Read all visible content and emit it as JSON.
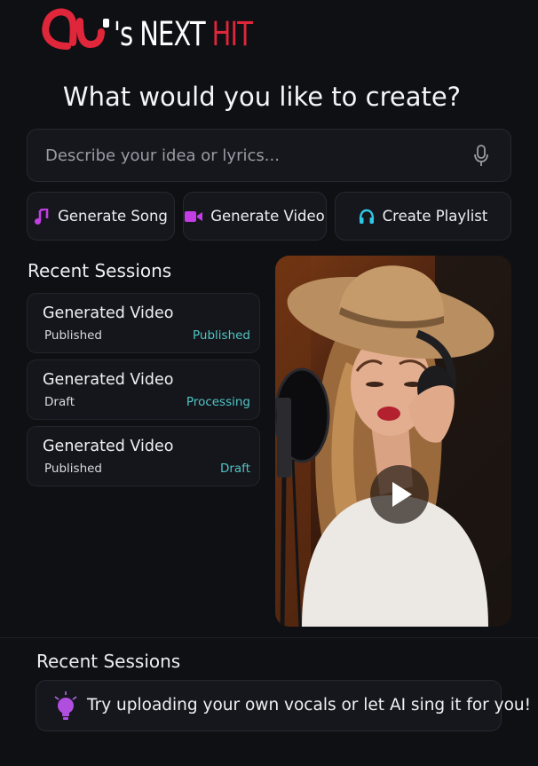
{
  "brand": {
    "logo_mark": "AI",
    "logo_s": "'s",
    "logo_next": "NEXT",
    "logo_hit": "HIT",
    "accent_red": "#e0263a"
  },
  "headline": "What would you like to create?",
  "prompt": {
    "placeholder": "Describe your idea or lyrics...",
    "value": "",
    "icon": "microphone-icon"
  },
  "actions": [
    {
      "label": "Generate Song",
      "icon": "music-note-icon",
      "color": "#c23de3"
    },
    {
      "label": "Generate Video",
      "icon": "video-camera-icon",
      "color": "#c23de3"
    },
    {
      "label": "Create Playlist",
      "icon": "headphones-icon",
      "color": "#2ec8e6"
    }
  ],
  "recent_sessions": {
    "title": "Recent Sessions",
    "items": [
      {
        "title": "Generated Video",
        "subtitle": "Published",
        "status": "Published"
      },
      {
        "title": "Generated Video",
        "subtitle": "Draft",
        "status": "Processing"
      },
      {
        "title": "Generated Video",
        "subtitle": "Published",
        "status": "Draft"
      }
    ],
    "status_color": "#4fc4c4"
  },
  "video_preview": {
    "icon": "play-icon"
  },
  "tips": {
    "title": "Recent Sessions",
    "text": "Try uploading your own vocals or let AI sing it for you!",
    "icon": "lightbulb-icon"
  }
}
